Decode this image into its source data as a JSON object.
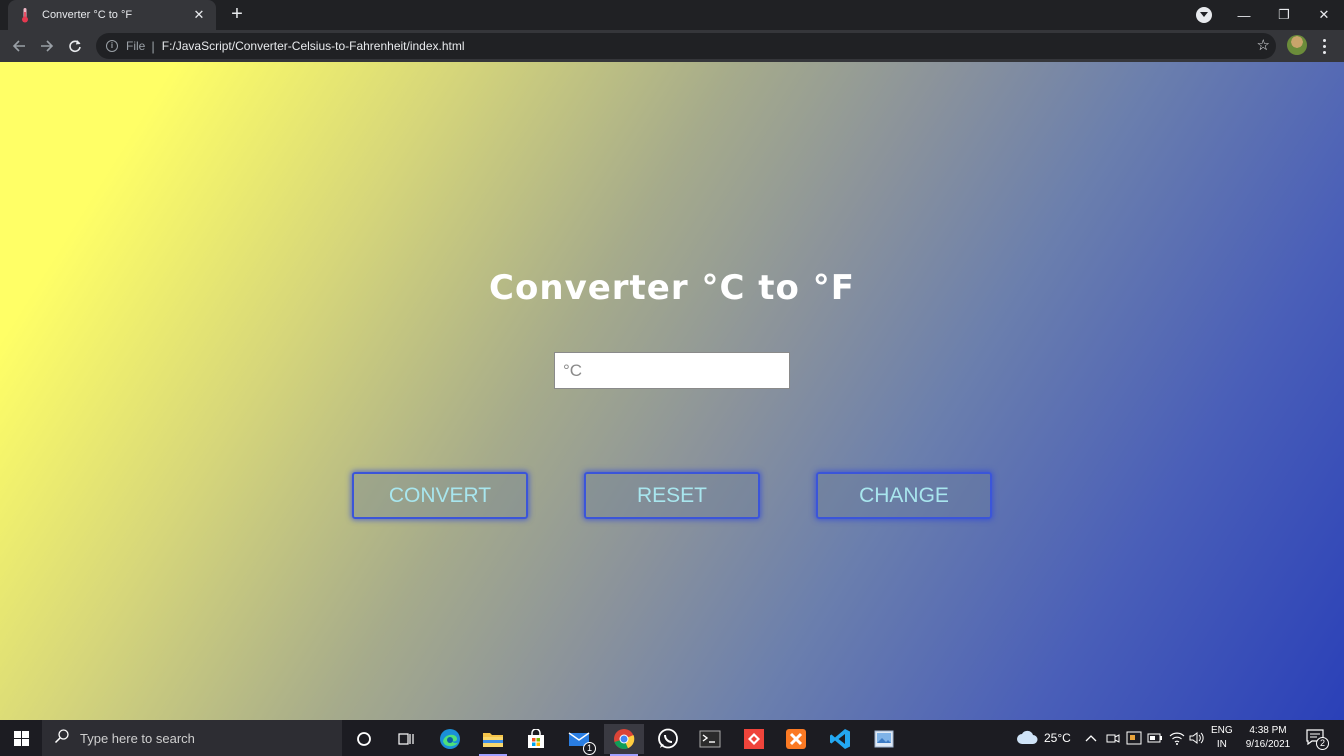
{
  "browser": {
    "tab_title": "Converter °C to °F",
    "tab_close": "✕",
    "new_tab": "+",
    "omnibox_scheme": "File",
    "omnibox_separator": "|",
    "url": "F:/JavaScript/Converter-Celsius-to-Fahrenheit/index.html",
    "bookmark_star": "☆",
    "window_controls": {
      "minimize": "—",
      "restore": "❐",
      "close": "✕"
    }
  },
  "page": {
    "heading": "Converter °C to °F",
    "input_placeholder": "°C",
    "input_value": "",
    "buttons": {
      "convert": "CONVERT",
      "reset": "RESET",
      "change": "CHANGE"
    },
    "colors": {
      "gradient_start": "#ffff66",
      "gradient_end": "#2a40b8",
      "button_border": "#3b55d9",
      "button_text": "#a8e6ee"
    }
  },
  "taskbar": {
    "search_placeholder": "Type here to search",
    "mail_badge": "1",
    "weather": "25°C",
    "language_top": "ENG",
    "language_bottom": "IN",
    "time": "4:38 PM",
    "date": "9/16/2021",
    "notification_count": "2"
  }
}
